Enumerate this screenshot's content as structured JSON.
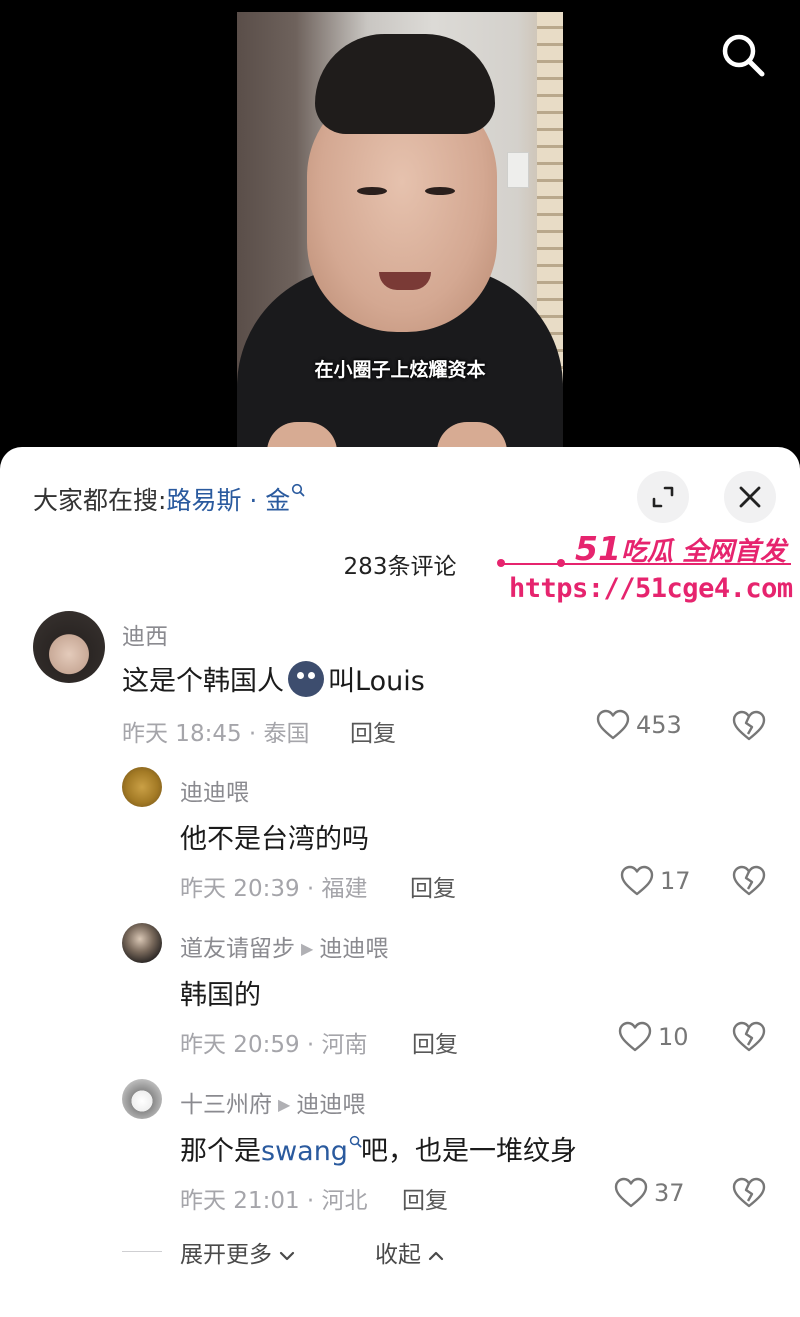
{
  "video": {
    "caption": "在小圈子上炫耀资本"
  },
  "panel": {
    "search_prefix": "大家都在搜:",
    "search_term": "路易斯 · 金",
    "comment_count": "283条评论"
  },
  "watermark": {
    "num": "51",
    "text": "吃瓜 全网首发",
    "url": "https://51cge4.com"
  },
  "comments": [
    {
      "user": "迪西",
      "text_a": "这是个韩国人",
      "text_b": "叫Louis",
      "meta": "昨天 18:45 · 泰国",
      "reply": "回复",
      "likes": "453"
    },
    {
      "user": "迪迪喂",
      "text": "他不是台湾的吗",
      "meta": "昨天 20:39 · 福建",
      "reply": "回复",
      "likes": "17"
    },
    {
      "user": "道友请留步",
      "reply_to": "迪迪喂",
      "text": "韩国的",
      "meta": "昨天 20:59 · 河南",
      "reply": "回复",
      "likes": "10"
    },
    {
      "user": "十三州府",
      "reply_to": "迪迪喂",
      "text_a": "那个是",
      "text_link": "swang",
      "text_b": "吧，也是一堆纹身",
      "meta": "昨天 21:01 · 河北",
      "reply": "回复",
      "likes": "37"
    }
  ],
  "footer": {
    "expand_more": "展开更多",
    "collapse": "收起"
  },
  "colors": {
    "link": "#2a5a9e",
    "watermark": "#e6246e"
  }
}
